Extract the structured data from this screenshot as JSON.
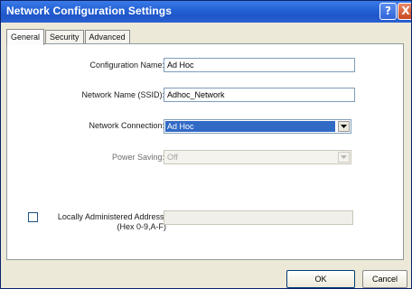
{
  "window": {
    "title": "Network Configuration Settings",
    "help_symbol": "?",
    "close_symbol": "X"
  },
  "tabs": [
    {
      "label": "General",
      "active": true
    },
    {
      "label": "Security",
      "active": false
    },
    {
      "label": "Advanced",
      "active": false
    }
  ],
  "form": {
    "config_name_label": "Configuration Name:",
    "config_name_value": "Ad Hoc",
    "ssid_label": "Network Name (SSID):",
    "ssid_value": "Adhoc_Network",
    "connection_label": "Network Connection:",
    "connection_value": "Ad Hoc",
    "power_label": "Power Saving:",
    "power_value": "Off",
    "laa_label_line1": "Locally Administered Address:",
    "laa_label_line2": "(Hex 0-9,A-F)",
    "laa_checked": false,
    "laa_value": ""
  },
  "buttons": {
    "ok": "OK",
    "cancel": "Cancel"
  },
  "colors": {
    "titlebar": "#2563d6",
    "selection": "#316ac5",
    "dialog_bg": "#ece9d8"
  }
}
